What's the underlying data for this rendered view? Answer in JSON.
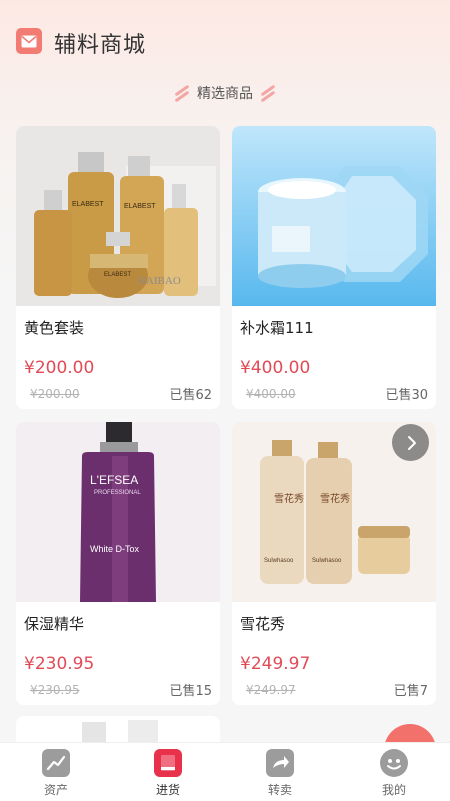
{
  "header": {
    "title": "辅料商城"
  },
  "section": {
    "title": "精选商品"
  },
  "products": [
    {
      "name": "黄色套装",
      "price": "¥200.00",
      "original_price": "¥200.00",
      "sold": "已售62"
    },
    {
      "name": "补水霜111",
      "price": "¥400.00",
      "original_price": "¥400.00",
      "sold": "已售30"
    },
    {
      "name": "保湿精华",
      "price": "¥230.95",
      "original_price": "¥230.95",
      "sold": "已售15"
    },
    {
      "name": "雪花秀",
      "price": "¥249.97",
      "original_price": "¥249.97",
      "sold": "已售7"
    }
  ],
  "product_images": {
    "elabest_brand": "ELABEST",
    "haibao_watermark": "HAIBAO",
    "lefsea_brand": "L'EFSEA",
    "lefsea_line": "PROFESSIONAL",
    "lefsea_product": "White D-Tox",
    "sulwhasoo_brand": "Sulwhasoo",
    "sulwhasoo_logo": "雪花秀"
  },
  "tabbar": {
    "items": [
      {
        "label": "资产",
        "icon": "chart-icon"
      },
      {
        "label": "进货",
        "icon": "stock-icon"
      },
      {
        "label": "转卖",
        "icon": "share-icon"
      },
      {
        "label": "我的",
        "icon": "face-icon"
      }
    ],
    "active_index": 1
  },
  "colors": {
    "accent": "#e14b57",
    "brand": "#f27b73",
    "background": "#f6f6f6"
  }
}
